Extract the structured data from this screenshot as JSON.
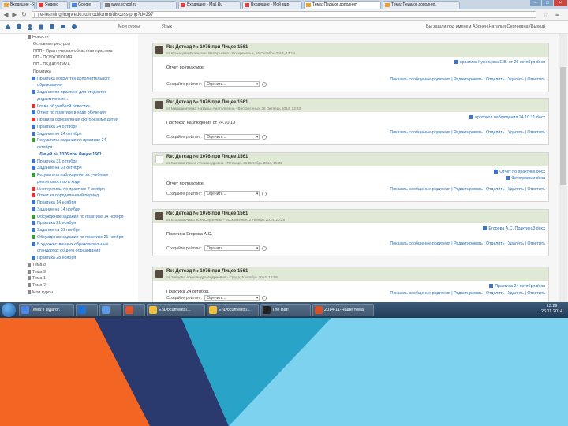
{
  "browser": {
    "tabs": [
      {
        "label": "Входящие - Яндекс.Почта",
        "color": "#f2a33a"
      },
      {
        "label": "Яндекс",
        "color": "#e33"
      },
      {
        "label": "Google",
        "color": "#4a86e8"
      },
      {
        "label": "www.school.ru",
        "color": "#7a7a7a"
      },
      {
        "label": "Входящие - Mail.Ru",
        "color": "#d44"
      },
      {
        "label": "Входящие - Мой мир",
        "color": "#d44"
      },
      {
        "label": "Тема: Педагог дополнит.",
        "color": "#f0a030"
      },
      {
        "label": "Тема: Педагог дополнит.",
        "color": "#f0a030"
      }
    ],
    "url": "e-learning.irogv.edu.ru/mod/forum/discuss.php?d=297",
    "window_controls": [
      "–",
      "□",
      "×"
    ]
  },
  "site": {
    "menu": [
      "Мои курсы",
      "Язык"
    ],
    "user_status": "Вы зашли под именем Абонен Наталья Сергеевна (Выход)"
  },
  "sidebar": {
    "items": [
      {
        "label": "Новости",
        "style": "plain",
        "icon": "bullet"
      },
      {
        "label": "Основные ресурсы",
        "style": "plain",
        "icon": "none"
      },
      {
        "label": "ППП - Практическая областная практика",
        "style": "plain",
        "icon": "none"
      },
      {
        "label": "ПП - ПСИХОЛОГИЯ",
        "style": "plain",
        "icon": "none"
      },
      {
        "label": "ПП - ПЕДАГОГИКА",
        "style": "plain",
        "icon": "none"
      },
      {
        "label": "Практика",
        "style": "plain",
        "icon": "none"
      },
      {
        "label": "Практика вокруг тех дополнительного",
        "style": "link",
        "icon": "doc"
      },
      {
        "label": "образования",
        "style": "link",
        "icon": "none"
      },
      {
        "label": "Задание по практике для студентов",
        "style": "link",
        "icon": "doc"
      },
      {
        "label": "дидактических...",
        "style": "link",
        "icon": "none"
      },
      {
        "label": "Глава об учебной повестке",
        "style": "link",
        "icon": "red"
      },
      {
        "label": "Отчет по практике в ходе обучения",
        "style": "link",
        "icon": "doc"
      },
      {
        "label": "Правила оформления фоторезюме детей",
        "style": "link",
        "icon": "red"
      },
      {
        "label": "Практика 24 октября",
        "style": "link",
        "icon": "doc"
      },
      {
        "label": "Задание по 24 октября",
        "style": "link",
        "icon": "doc"
      },
      {
        "label": "Результаты задания по практике 24",
        "style": "link",
        "icon": "green"
      },
      {
        "label": "октября",
        "style": "link",
        "icon": "none"
      },
      {
        "label": "Лицей № 1076 при Лицее 1561",
        "style": "bold",
        "icon": "none"
      },
      {
        "label": "Практика 31 октября",
        "style": "link",
        "icon": "doc"
      },
      {
        "label": "Задание на 31 октября",
        "style": "link",
        "icon": "doc"
      },
      {
        "label": "Результаты наблюдения за учебным",
        "style": "link",
        "icon": "green"
      },
      {
        "label": "деятельностью в ходе",
        "style": "link",
        "icon": "none"
      },
      {
        "label": "Инструктивы по практике 7 ноября",
        "style": "link",
        "icon": "red"
      },
      {
        "label": "Отчет за определенный период",
        "style": "link",
        "icon": "red"
      },
      {
        "label": "Практика 14 ноября",
        "style": "link",
        "icon": "doc"
      },
      {
        "label": "Задание на 14 ноября",
        "style": "link",
        "icon": "doc"
      },
      {
        "label": "Обсуждение задания по практике 14 ноября",
        "style": "link",
        "icon": "green"
      },
      {
        "label": "Практика 21 ноября",
        "style": "link",
        "icon": "doc"
      },
      {
        "label": "Задание на 21 ноября",
        "style": "link",
        "icon": "doc"
      },
      {
        "label": "Обсуждение задания по практике 21 ноября",
        "style": "link",
        "icon": "green"
      },
      {
        "label": "В художественных образовательных",
        "style": "link",
        "icon": "doc"
      },
      {
        "label": "стандартах общего образования",
        "style": "link",
        "icon": "none"
      },
      {
        "label": "Практика 28 ноября",
        "style": "link",
        "icon": "doc"
      },
      {
        "label": "Тема 8",
        "style": "plain",
        "icon": "bullet"
      },
      {
        "label": "Тема 9",
        "style": "plain",
        "icon": "bullet"
      },
      {
        "label": "Тема 1",
        "style": "plain",
        "icon": "bullet"
      },
      {
        "label": "Тема 2",
        "style": "plain",
        "icon": "bullet"
      },
      {
        "label": "Мои курсы",
        "style": "plain",
        "icon": "bullet"
      }
    ]
  },
  "posts": [
    {
      "title": "Re: Детсад № 1076 при Лицее 1561",
      "author": "от Кузнецова Екатерина Валерьевна - Воскресенье, 26 Октябрь 2014, 13:18",
      "attachments": [
        "практика Кузнецова Е.В. от 26 октября.docx"
      ],
      "text": "Отчет по практике.",
      "actions": "Показать сообщение-родителя | Редактировать | Отделить | Удалить | Ответить",
      "rating_label": "Создайте рейтинг:",
      "rating_value": "Оценить...",
      "avatar": "photo"
    },
    {
      "title": "Re: Детсад № 1076 при Лицее 1561",
      "author": "от Мирошниченко Наталья Анатольевна - Воскресенье, 26 Октябрь 2014, 13:43",
      "attachments": [
        "протокол наблюдения 24.10.31.docx"
      ],
      "text": "Протокол наблюдения от 24.10.13",
      "actions": "Показать сообщение-родителя | Редактировать | Отделить | Удалить | Ответить",
      "rating_label": "Создайте рейтинг:",
      "rating_value": "Оценить...",
      "avatar": "photo"
    },
    {
      "title": "Re: Детсад № 1076 при Лицее 1561",
      "author": "от Козлова Ирина Александровна - Пятница, 31 Октябрь 2014, 15:31",
      "attachments": [
        "Отчет по практике.docx",
        "Фотографии.docx"
      ],
      "text": "Отчет по практике.",
      "actions": "Показать сообщение-родителя | Редактировать | Отделить | Удалить | Ответить",
      "rating_label": "Создайте рейтинг:",
      "rating_value": "Оценить...",
      "avatar": "blank"
    },
    {
      "title": "Re: Детсад № 1076 при Лицее 1561",
      "author": "от Егорова Анастасия Сергеевна - Воскресенье, 2 Ноябрь 2014, 20:25",
      "attachments": [
        "Егорова А.С. Практика3.docx"
      ],
      "text": "Практика Егорова А.С.",
      "actions": "Показать сообщение-родителя | Редактировать | Отделить | Удалить | Ответить",
      "rating_label": "Создайте рейтинг:",
      "rating_value": "Оценить...",
      "avatar": "photo"
    },
    {
      "title": "Re: Детсад № 1076 при Лицее 1561",
      "author": "от Зайцева Александра Андреевна - Среда, 5 Ноябрь 2014, 16:06",
      "attachments": [
        "Практика 24 октября.docx"
      ],
      "text": "Практика 24 октября.",
      "actions": "Показать сообщение-родителя | Редактировать | Отделить | Удалить | Ответить",
      "rating_label": "Создайте рейтинг:",
      "rating_value": "Оценить...",
      "avatar": "photo"
    }
  ],
  "taskbar": {
    "items": [
      {
        "label": "Тема: Педагог.",
        "color": "#4a86e8"
      },
      {
        "label": "",
        "color": "#1e74d8"
      },
      {
        "label": "",
        "color": "#5a9ae8"
      },
      {
        "label": "",
        "color": "#d53"
      },
      {
        "label": "E:\\Documents\\...",
        "color": "#f0c040"
      },
      {
        "label": "E:\\Documents\\...",
        "color": "#f0c040"
      },
      {
        "label": "The Bat!",
        "color": "#222"
      },
      {
        "label": "2014-11-Наше тема",
        "color": "#d5532b"
      }
    ],
    "time": "13:29",
    "date": "26.11.2014"
  },
  "colors": {
    "orange": "#f26522",
    "navy": "#2a3a6e",
    "teal": "#2aa3c9",
    "cyan": "#7dd3ef"
  }
}
